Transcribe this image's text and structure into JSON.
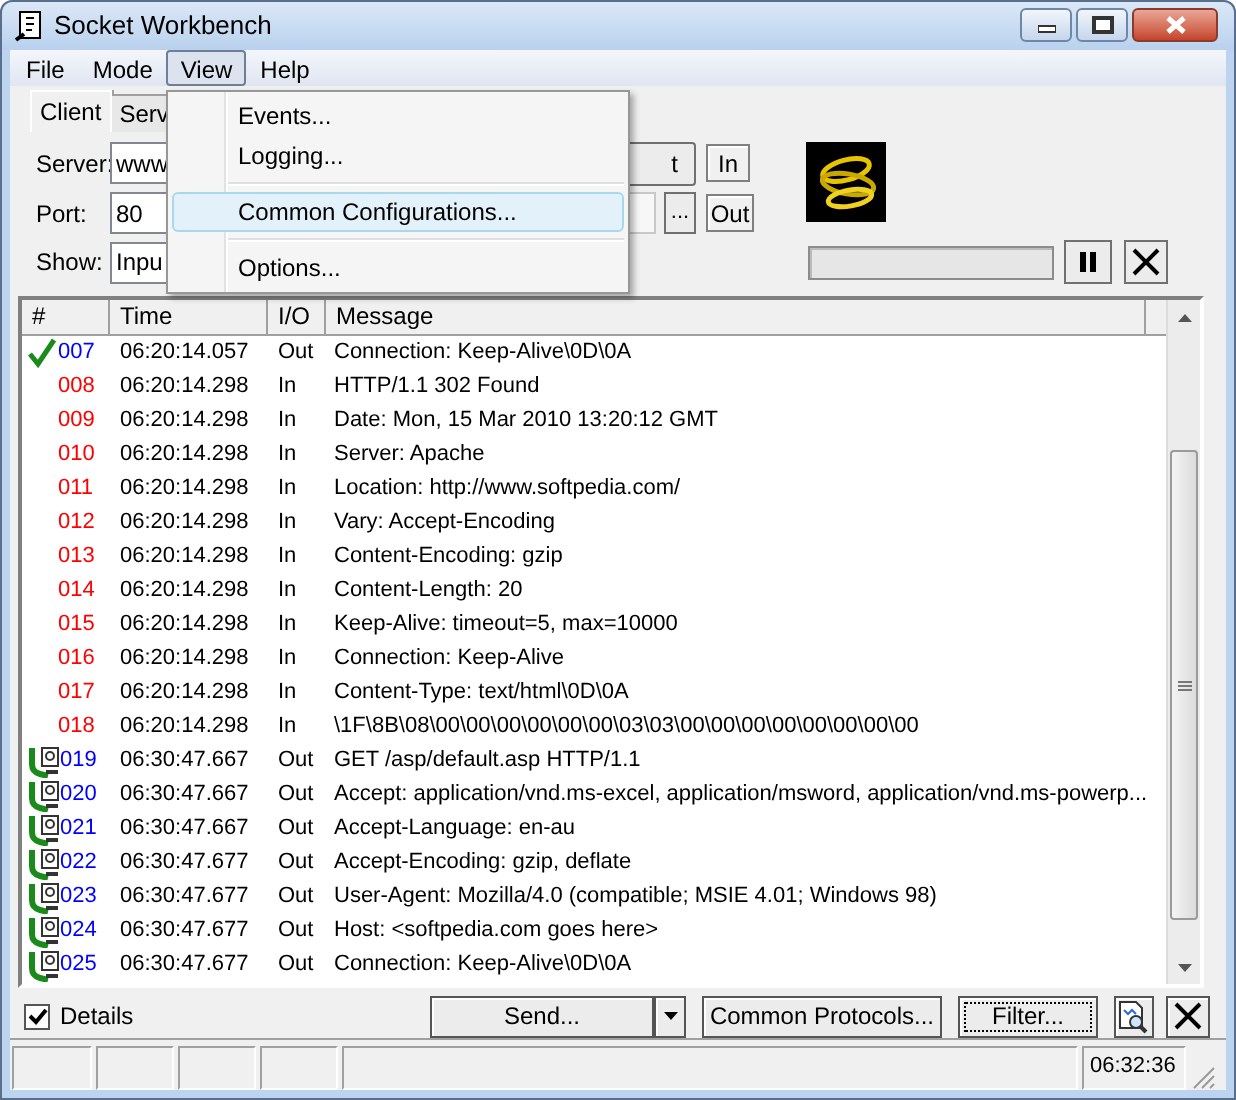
{
  "window": {
    "title": "Socket Workbench"
  },
  "menu_bar": [
    {
      "label": "File",
      "selected": false
    },
    {
      "label": "Mode",
      "selected": false
    },
    {
      "label": "View",
      "selected": true
    },
    {
      "label": "Help",
      "selected": false
    }
  ],
  "view_menu": [
    {
      "kind": "item",
      "label": "Events...",
      "selected": false
    },
    {
      "kind": "item",
      "label": "Logging...",
      "selected": false
    },
    {
      "kind": "separator"
    },
    {
      "kind": "item",
      "label": "Common Configurations...",
      "selected": true
    },
    {
      "kind": "separator"
    },
    {
      "kind": "item",
      "label": "Options...",
      "selected": false
    }
  ],
  "tabs": [
    {
      "label": "Client",
      "selected": true
    },
    {
      "label": "Serv",
      "selected": false
    }
  ],
  "server": {
    "label": "Server:",
    "value": "www",
    "button": "t",
    "in_label": "In"
  },
  "port": {
    "label": "Port:",
    "value": "80",
    "browse_button": "...",
    "out_label": "Out"
  },
  "show": {
    "label": "Show:",
    "value": "Inpu"
  },
  "log": {
    "columns": [
      "#",
      "Time",
      "I/O",
      "Message"
    ],
    "rows": [
      {
        "kind": "sent-ok",
        "num": "007",
        "time": "06:20:14.057",
        "io": "Out",
        "message": "Connection: Keep-Alive\\0D\\0A"
      },
      {
        "kind": "received",
        "num": "008",
        "time": "06:20:14.298",
        "io": "In",
        "message": "HTTP/1.1 302 Found"
      },
      {
        "kind": "received",
        "num": "009",
        "time": "06:20:14.298",
        "io": "In",
        "message": "Date: Mon, 15 Mar 2010 13:20:12 GMT"
      },
      {
        "kind": "received",
        "num": "010",
        "time": "06:20:14.298",
        "io": "In",
        "message": "Server: Apache"
      },
      {
        "kind": "received",
        "num": "011",
        "time": "06:20:14.298",
        "io": "In",
        "message": "Location: http://www.softpedia.com/"
      },
      {
        "kind": "received",
        "num": "012",
        "time": "06:20:14.298",
        "io": "In",
        "message": "Vary: Accept-Encoding"
      },
      {
        "kind": "received",
        "num": "013",
        "time": "06:20:14.298",
        "io": "In",
        "message": "Content-Encoding: gzip"
      },
      {
        "kind": "received",
        "num": "014",
        "time": "06:20:14.298",
        "io": "In",
        "message": "Content-Length: 20"
      },
      {
        "kind": "received",
        "num": "015",
        "time": "06:20:14.298",
        "io": "In",
        "message": "Keep-Alive: timeout=5, max=10000"
      },
      {
        "kind": "received",
        "num": "016",
        "time": "06:20:14.298",
        "io": "In",
        "message": "Connection: Keep-Alive"
      },
      {
        "kind": "received",
        "num": "017",
        "time": "06:20:14.298",
        "io": "In",
        "message": "Content-Type: text/html\\0D\\0A"
      },
      {
        "kind": "received",
        "num": "018",
        "time": "06:20:14.298",
        "io": "In",
        "message": "\\1F\\8B\\08\\00\\00\\00\\00\\00\\00\\03\\03\\00\\00\\00\\00\\00\\00\\00\\00"
      },
      {
        "kind": "sent",
        "num": "019",
        "time": "06:30:47.667",
        "io": "Out",
        "message": "GET /asp/default.asp HTTP/1.1"
      },
      {
        "kind": "sent",
        "num": "020",
        "time": "06:30:47.667",
        "io": "Out",
        "message": "Accept: application/vnd.ms-excel, application/msword, application/vnd.ms-powerp..."
      },
      {
        "kind": "sent",
        "num": "021",
        "time": "06:30:47.667",
        "io": "Out",
        "message": "Accept-Language: en-au"
      },
      {
        "kind": "sent",
        "num": "022",
        "time": "06:30:47.677",
        "io": "Out",
        "message": "Accept-Encoding: gzip, deflate"
      },
      {
        "kind": "sent",
        "num": "023",
        "time": "06:30:47.677",
        "io": "Out",
        "message": "User-Agent: Mozilla/4.0 (compatible; MSIE 4.01; Windows 98)"
      },
      {
        "kind": "sent",
        "num": "024",
        "time": "06:30:47.677",
        "io": "Out",
        "message": "Host: <softpedia.com goes here>"
      },
      {
        "kind": "sent",
        "num": "025",
        "time": "06:30:47.677",
        "io": "Out",
        "message": "Connection: Keep-Alive\\0D\\0A"
      }
    ]
  },
  "details": {
    "label": "Details",
    "checked": true
  },
  "buttons": {
    "send": "Send...",
    "protocols": "Common Protocols...",
    "filter": "Filter..."
  },
  "status_bar": {
    "time": "06:32:36"
  }
}
